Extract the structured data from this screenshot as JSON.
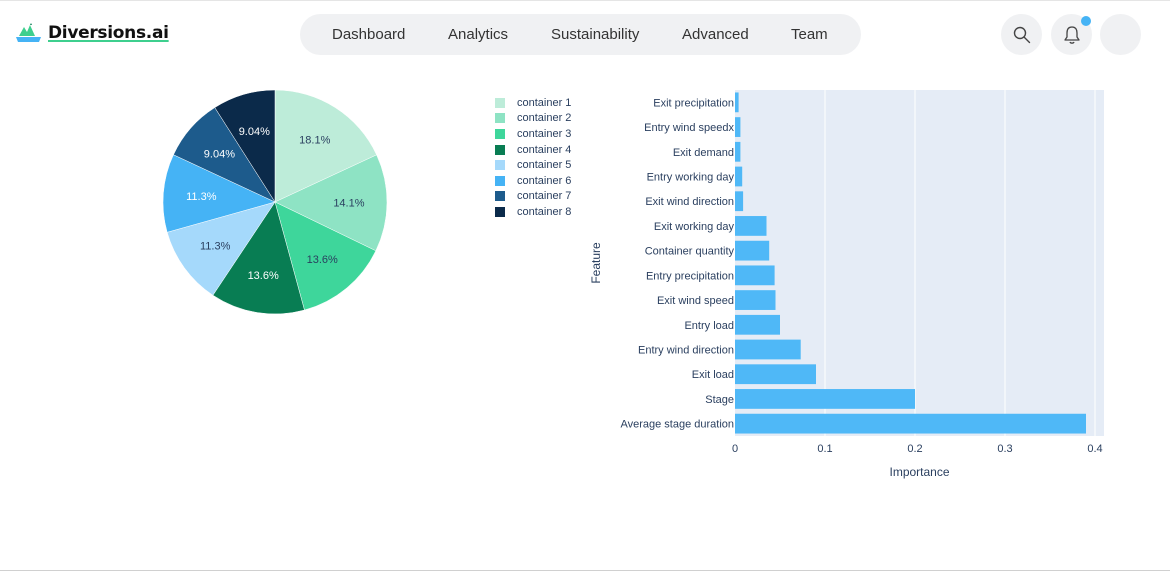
{
  "app": {
    "logo_text": "Diversions.ai"
  },
  "nav": {
    "items": [
      {
        "label": "Dashboard"
      },
      {
        "label": "Analytics"
      },
      {
        "label": "Sustainability"
      },
      {
        "label": "Advanced"
      },
      {
        "label": "Team"
      }
    ]
  },
  "header_actions": {
    "search_icon": "search-icon",
    "notifications_icon": "bell-icon",
    "notification_dot_color": "#45b3f5"
  },
  "colors": {
    "accent": "#3ecf8e",
    "bar": "#4fb8f7",
    "plot_bg": "#e5ecf6"
  },
  "chart_data": [
    {
      "type": "pie",
      "categories": [
        "container 1",
        "container 2",
        "container 3",
        "container 4",
        "container 5",
        "container 6",
        "container 7",
        "container 8"
      ],
      "values": [
        18.1,
        14.1,
        13.6,
        13.6,
        11.3,
        11.3,
        9.04,
        9.04
      ],
      "labels": [
        "18.1%",
        "14.1%",
        "13.6%",
        "13.6%",
        "11.3%",
        "11.3%",
        "9.04%",
        "9.04%"
      ],
      "colors": [
        "#bdecd9",
        "#8ee3c4",
        "#3ed69b",
        "#087d53",
        "#a5d9fb",
        "#45b3f5",
        "#1d5b8c",
        "#0b2a4a"
      ],
      "legend": "right"
    },
    {
      "type": "bar",
      "orientation": "horizontal",
      "categories": [
        "Exit precipitation",
        "Entry wind speedx",
        "Exit demand",
        "Entry working day",
        "Exit wind direction",
        "Exit working day",
        "Container quantity",
        "Entry precipitation",
        "Exit wind speed",
        "Entry load",
        "Entry wind direction",
        "Exit load",
        "Stage",
        "Average stage duration"
      ],
      "values": [
        0.004,
        0.006,
        0.006,
        0.008,
        0.009,
        0.035,
        0.038,
        0.044,
        0.045,
        0.05,
        0.073,
        0.09,
        0.2,
        0.39
      ],
      "xlabel": "Importance",
      "ylabel": "Feature",
      "xlim": [
        0,
        0.41
      ],
      "xticks": [
        0,
        0.1,
        0.2,
        0.3,
        0.4
      ],
      "xtick_labels": [
        "0",
        "0.1",
        "0.2",
        "0.3",
        "0.4"
      ],
      "grid": true
    }
  ]
}
